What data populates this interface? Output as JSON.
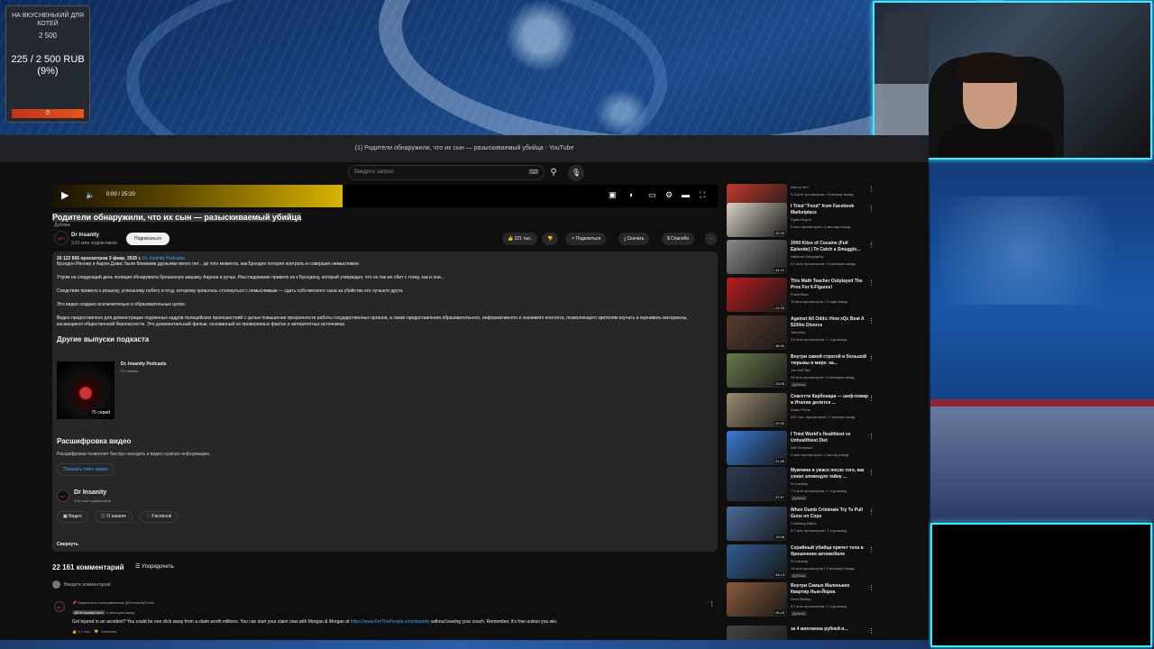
{
  "donation": {
    "title": "НА ВКУСНЕНЬКИЙ ДЛЯ КОТЕЙ",
    "goal": "2 500",
    "progress": "225 / 2 500 RUB",
    "percent_label": "(9%)",
    "bar_label": "0",
    "fraction": 0.09
  },
  "browser": {
    "tab_title": "(1) Родители обнаружили, что их сын — разыскиваемый убийца - YouTube",
    "search_placeholder": "Введите запрос"
  },
  "player": {
    "time": "0:00 / 25:20"
  },
  "video": {
    "title": "Родители обнаружили, что их сын — разыскиваемый убийца",
    "subtitle": "Дубляж",
    "channel": "Dr Insanity",
    "channel_avatar": "DR I",
    "subscribers": "3,61 млн подписчиков",
    "subscribe_label": "Подписаться",
    "likes": "221 тыс.",
    "share_label": "Поделиться",
    "download_label": "Скачать",
    "thanks_label": "Спасибо"
  },
  "description": {
    "views_date": "20 122 856 просмотров  3 февр. 2025 г.",
    "podcast_link": "Dr. Insanity Podcasts",
    "p1": "Брэндон Риснер и Аарон Дэвис были близкими друзьями много лет... до того момента, как Брэндон потерял контроль и совершил немыслимое.",
    "p2": "Утром на следующий день полиция обнаружила брошенную машину Аарона в ручье. Расследование привело их к Брэндону, который утверждал, что он так же сбит с толку, как и они...",
    "p3": "Следствие привело к розыску, успешному побегу и отцу, которому пришлось столкнуться с немыслимым — сдать собственного сына за убийство его лучшего друга.",
    "p4": "Это видео создано исключительно в образовательных целях.",
    "p5": "Видео предоставлено для демонстрации подлинных кадров полицейских происшествий с целью повышения прозрачности работы государственных органов, а также предоставления образовательного, информативного и значимого контента, позволяющего зрителям изучать и оценивать материалы, касающиеся общественной безопасности. Это документальный фильм, основанный на проверенных фактах и авторитетных источниках.",
    "other_episodes": "Другие выпуски подкаста",
    "podcast_title": "Dr. Insanity Podcasts",
    "podcast_channel": "Dr Insanity",
    "podcast_count": "75 серий",
    "transcript_heading": "Расшифровка видео",
    "transcript_text": "Расшифровка позволяет быстро находить в видео нужную информацию.",
    "transcript_button": "Показать текст видео",
    "channel": "Dr Insanity",
    "channel_subs": "3,61 млн подписчиков",
    "link_video": "Видео",
    "link_about": "О канале",
    "link_facebook": "Facebook",
    "collapse": "Свернуть"
  },
  "comments": {
    "count_label": "22 161 комментарий",
    "sort_label": "Упорядочить",
    "add_placeholder": "Введите комментарий",
    "pinned": "Закреплено пользователем @DrInsanityCrime",
    "author": "@DrInsanityCrime",
    "time": "9 месяцев назад",
    "text_before": "Got injured in an accident? You could be one click away from a claim worth millions. You can start your claim now with Morgan & Morgan at",
    "link": "https://www.ForThePeople.com/insanity",
    "text_after": "without leaving your couch. Remember, it's free unless you win.",
    "likes": "1,7 тыс.",
    "reply": "Ответить"
  },
  "recommendations": [
    {
      "title": "",
      "channel": "Danny Kim",
      "meta": "5,3 млн просмотров • 3 месяца назад",
      "duration": "23:56",
      "color": "#c0392b",
      "badge": ""
    },
    {
      "title": "I Tried \"Food\" from Facebook Marketplace",
      "channel": "Dylan Huynh",
      "meta": "5 млн просмотров • 4 месяца назад",
      "duration": "22:20",
      "color": "#d9d2c5",
      "badge": ""
    },
    {
      "title": "2000 Kilos of Cocaine (Full Episode) | To Catch a Smuggle...",
      "channel": "National Geographic",
      "meta": "5,2 млн просмотров • 9 месяцев назад",
      "duration": "44:21",
      "color": "#8a8a8a",
      "badge": ""
    },
    {
      "title": "This Math Teacher Outplayed The Pros For 6-Figures!",
      "channel": "PokerStars",
      "meta": "19 млн просмотров • 3 года назад",
      "duration": "21:03",
      "color": "#b81c1c",
      "badge": ""
    },
    {
      "title": "Against All Odds: How xQc Beat A $100m Divorce",
      "channel": "Jabroney",
      "meta": "3,9 млн просмотров • 1 год назад",
      "duration": "46:46",
      "color": "#5a3a2a",
      "badge": ""
    },
    {
      "title": "Внутри самой строгой и большой тюрьмы в мире: ка...",
      "channel": "Joe HaTTab",
      "meta": "93 млн просмотров • 9 месяцев назад",
      "duration": "23:05",
      "color": "#6b7a4a",
      "badge": "Дубляж"
    },
    {
      "title": "Спагетти Карбонара — шеф-повар в Италии делится ...",
      "channel": "Adam Firma",
      "meta": "621 тыс. просмотров • 2 месяца назад",
      "duration": "20:32",
      "color": "#9a8b70",
      "badge": ""
    },
    {
      "title": "I Tried World's Healthiest vs Unhealthiest Diet",
      "channel": "Will Tennyson",
      "meta": "4 млн просмотров • 1 месяц назад",
      "duration": "31:58",
      "color": "#3a7bd5",
      "badge": ""
    },
    {
      "title": "Мужчина в ужасе после того, как узнал зловещую тайну ...",
      "channel": "Dr Insanity",
      "meta": "7,4 млн просмотров • 1 год назад",
      "duration": "37:57",
      "color": "#2b3a55",
      "badge": "Дубляж"
    },
    {
      "title": "When Dumb Criminals Try To Pull Guns on Cops",
      "channel": "Clutching Killers",
      "meta": "5,7 млн просмотров • 1 год назад",
      "duration": "19:08",
      "color": "#4a6a9a",
      "badge": ""
    },
    {
      "title": "Серийный убийца прячет тела в брошенном автомобиле",
      "channel": "Dr Insanity",
      "meta": "14 млн просмотров • 5 месяцев назад",
      "duration": "36:13",
      "color": "#2f5b8f",
      "badge": "Дубляж"
    },
    {
      "title": "Внутри Самых Маленьких Квартир Нью-Йорка",
      "channel": "Drew Binsky",
      "meta": "6,1 млн просмотров • 1 год назад",
      "duration": "26:18",
      "color": "#8a5a3a",
      "badge": "Дубляж"
    },
    {
      "title": "за 4 миллиона рублей и...",
      "channel": "",
      "meta": "",
      "duration": "",
      "color": "#444",
      "badge": ""
    }
  ]
}
